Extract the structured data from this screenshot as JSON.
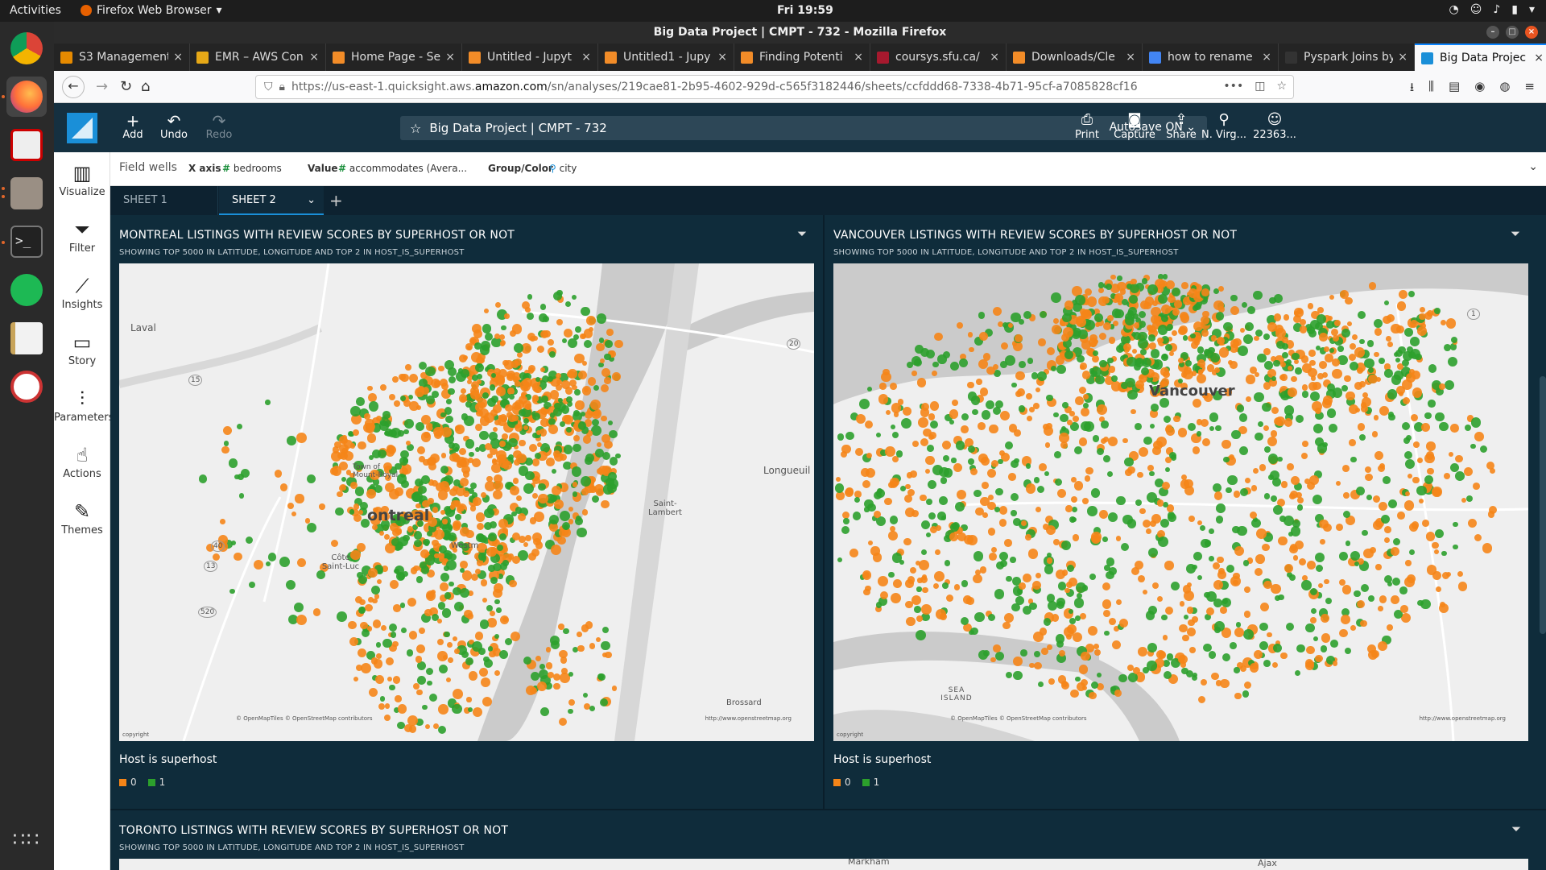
{
  "system": {
    "activities": "Activities",
    "app_menu": "Firefox Web Browser",
    "clock": "Fri 19:59"
  },
  "browser": {
    "window_title": "Big Data Project | CMPT - 732 - Mozilla Firefox",
    "tabs": [
      {
        "label": "S3 Management",
        "color": "#e68a00"
      },
      {
        "label": "EMR – AWS Con",
        "color": "#e6a817"
      },
      {
        "label": "Home Page - Se",
        "color": "#f28c28"
      },
      {
        "label": "Untitled - Jupyt",
        "color": "#f28c28"
      },
      {
        "label": "Untitled1 - Jupy",
        "color": "#f28c28"
      },
      {
        "label": "Finding Potenti",
        "color": "#f28c28"
      },
      {
        "label": "coursys.sfu.ca/",
        "color": "#a6192e"
      },
      {
        "label": "Downloads/Cle",
        "color": "#f28c28"
      },
      {
        "label": "how to rename",
        "color": "#4285f4"
      },
      {
        "label": "Pyspark Joins by E",
        "color": "#333333"
      },
      {
        "label": "Big Data Projec",
        "color": "#1a8fd8"
      }
    ],
    "url_prefix": "https://us-east-1.quicksight.aws.",
    "url_host": "amazon.com",
    "url_path": "/sn/analyses/219cae81-2b95-4602-929d-c565f3182446/sheets/ccfddd68-7338-4b71-95cf-a7085828cf16"
  },
  "quicksight": {
    "header": {
      "add": "Add",
      "undo": "Undo",
      "redo": "Redo",
      "title": "Big Data Project | CMPT - 732",
      "autosave": "Autosave ON",
      "print": "Print",
      "capture": "Capture",
      "share": "Share",
      "region": "N. Virg...",
      "account": "22363..."
    },
    "rail": {
      "visualize": "Visualize",
      "filter": "Filter",
      "insights": "Insights",
      "story": "Story",
      "parameters": "Parameters",
      "actions": "Actions",
      "themes": "Themes"
    },
    "field_wells": {
      "title": "Field wells",
      "x_axis_label": "X axis",
      "x_axis_value": "bedrooms",
      "value_label": "Value",
      "value_value": "accommodates (Avera...",
      "group_label": "Group/Color",
      "group_value": "city"
    },
    "sheets": [
      "SHEET 1",
      "SHEET 2"
    ],
    "visuals": {
      "montreal": {
        "title": "MONTREAL LISTINGS WITH REVIEW SCORES BY SUPERHOST OR NOT",
        "subtitle": "SHOWING TOP 5000 IN LATITUDE, LONGITUDE AND TOP 2 IN HOST_IS_SUPERHOST",
        "legend_title": "Host  is  superhost",
        "legend": [
          "0",
          "1"
        ],
        "labels": {
          "laval": "Laval",
          "longueuil": "Longueuil",
          "montreal": "ontreal",
          "saint_lambert": "Saint-Lambert",
          "cote": "Côte Saint-Luc",
          "brossard": "Brossard",
          "mont_royal": "Town of Mount-Royal",
          "westmount": "Westm",
          "r15": "15",
          "r20": "20",
          "r40": "40",
          "r13": "13",
          "r520": "520"
        },
        "attribution": "© OpenMapTiles © OpenStreetMap contributors",
        "url": "http://www.openstreetmap.org",
        "copyright": "copyright"
      },
      "vancouver": {
        "title": "VANCOUVER LISTINGS WITH REVIEW SCORES BY SUPERHOST OR NOT",
        "subtitle": "SHOWING TOP 5000 IN LATITUDE, LONGITUDE AND TOP 2 IN HOST_IS_SUPERHOST",
        "legend_title": "Host  is  superhost",
        "legend": [
          "0",
          "1"
        ],
        "labels": {
          "vancouver": "Vancouver",
          "sea_island": "SEA ISLAND",
          "r1": "1"
        },
        "attribution": "© OpenMapTiles © OpenStreetMap contributors",
        "url": "http://www.openstreetmap.org",
        "copyright": "copyright"
      },
      "toronto": {
        "title": "TORONTO LISTINGS WITH REVIEW SCORES BY SUPERHOST OR NOT",
        "subtitle": "SHOWING TOP 5000 IN LATITUDE, LONGITUDE AND TOP 2 IN HOST_IS_SUPERHOST",
        "labels": {
          "markham": "Markham",
          "ajax": "Ajax"
        }
      }
    },
    "colors": {
      "not_superhost": "#f58518",
      "superhost": "#2ca02c",
      "header_bg": "#153040",
      "accent": "#1a8fd8"
    }
  }
}
